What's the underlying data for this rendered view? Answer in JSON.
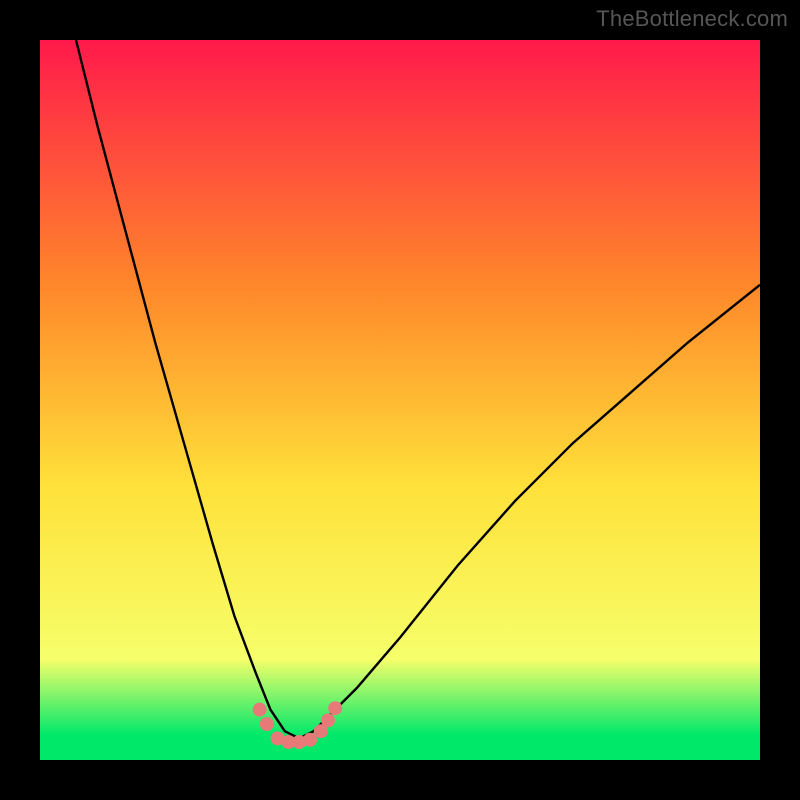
{
  "watermark": "TheBottleneck.com",
  "colors": {
    "bg": "#000000",
    "grad_top": "#ff1a4b",
    "grad_mid1": "#ff8a2a",
    "grad_mid2": "#ffe13a",
    "grad_low": "#f6ff6a",
    "grad_green": "#00e86a",
    "curve": "#000000",
    "marker": "#e77a78"
  },
  "chart_data": {
    "type": "line",
    "title": "",
    "xlabel": "",
    "ylabel": "",
    "xlim": [
      0,
      100
    ],
    "ylim": [
      0,
      100
    ],
    "legend": false,
    "grid": false,
    "series": [
      {
        "name": "bottleneck-curve",
        "x": [
          5,
          8,
          12,
          16,
          20,
          24,
          27,
          30,
          32,
          34,
          36,
          38,
          40,
          44,
          50,
          58,
          66,
          74,
          82,
          90,
          100
        ],
        "y": [
          100,
          88,
          73,
          58,
          44,
          30,
          20,
          12,
          7,
          4,
          3,
          4,
          6,
          10,
          17,
          27,
          36,
          44,
          51,
          58,
          66
        ]
      }
    ],
    "markers": {
      "name": "highlight-dots",
      "x": [
        30.5,
        31.5,
        33,
        34.5,
        36,
        37.5,
        39,
        40,
        41
      ],
      "y": [
        7,
        5,
        3,
        2.5,
        2.5,
        2.8,
        4,
        5.5,
        7.2
      ]
    },
    "gradient_stops": [
      {
        "offset": 0.0,
        "colorKey": "grad_top"
      },
      {
        "offset": 0.35,
        "colorKey": "grad_mid1"
      },
      {
        "offset": 0.62,
        "colorKey": "grad_mid2"
      },
      {
        "offset": 0.86,
        "colorKey": "grad_low"
      },
      {
        "offset": 0.965,
        "colorKey": "grad_green"
      },
      {
        "offset": 1.0,
        "colorKey": "grad_green"
      }
    ]
  }
}
